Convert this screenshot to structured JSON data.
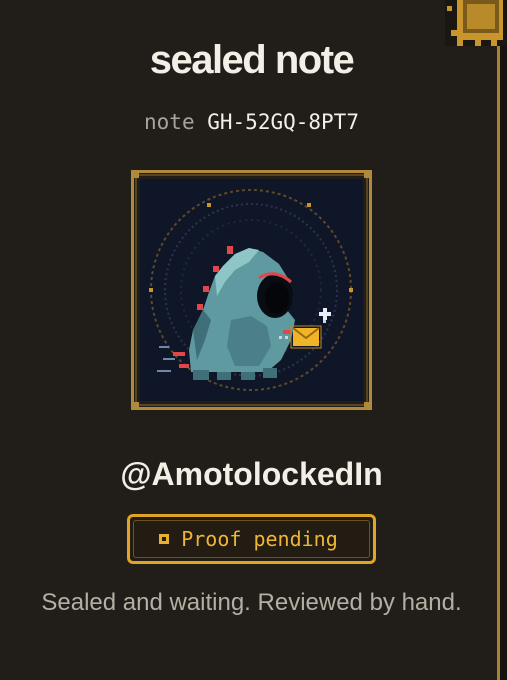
{
  "header": {
    "title": "sealed note",
    "note_prefix": "note",
    "note_code": "GH-52GQ-8PT7"
  },
  "profile": {
    "handle": "@AmotolockedIn",
    "avatar_icon": "pixel-creature-with-envelope"
  },
  "status": {
    "badge_label": "Proof pending",
    "badge_icon": "square-dot-icon",
    "description": "Sealed and waiting. Reviewed by hand."
  },
  "colors": {
    "background": "#211d18",
    "accent_gold": "#e0a526",
    "frame_gold": "#b08a3a",
    "text_primary": "#f3efe6",
    "text_muted": "#b4aea3"
  }
}
